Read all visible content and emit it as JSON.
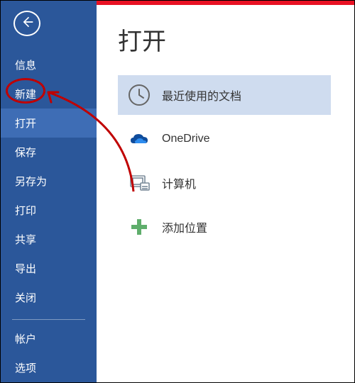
{
  "sidebar": {
    "items": [
      {
        "label": "信息"
      },
      {
        "label": "新建"
      },
      {
        "label": "打开"
      },
      {
        "label": "保存"
      },
      {
        "label": "另存为"
      },
      {
        "label": "打印"
      },
      {
        "label": "共享"
      },
      {
        "label": "导出"
      },
      {
        "label": "关闭"
      }
    ],
    "bottom_items": [
      {
        "label": "帐户"
      },
      {
        "label": "选项"
      }
    ],
    "selected_index": 2
  },
  "main": {
    "title": "打开",
    "options": [
      {
        "label": "最近使用的文档",
        "icon": "clock-icon"
      },
      {
        "label": "OneDrive",
        "icon": "onedrive-icon"
      },
      {
        "label": "计算机",
        "icon": "computer-icon"
      },
      {
        "label": "添加位置",
        "icon": "plus-icon"
      }
    ],
    "selected_option": 0
  },
  "colors": {
    "sidebar": "#2B579A",
    "accent_red": "#E81123",
    "annotation": "#C00000"
  }
}
